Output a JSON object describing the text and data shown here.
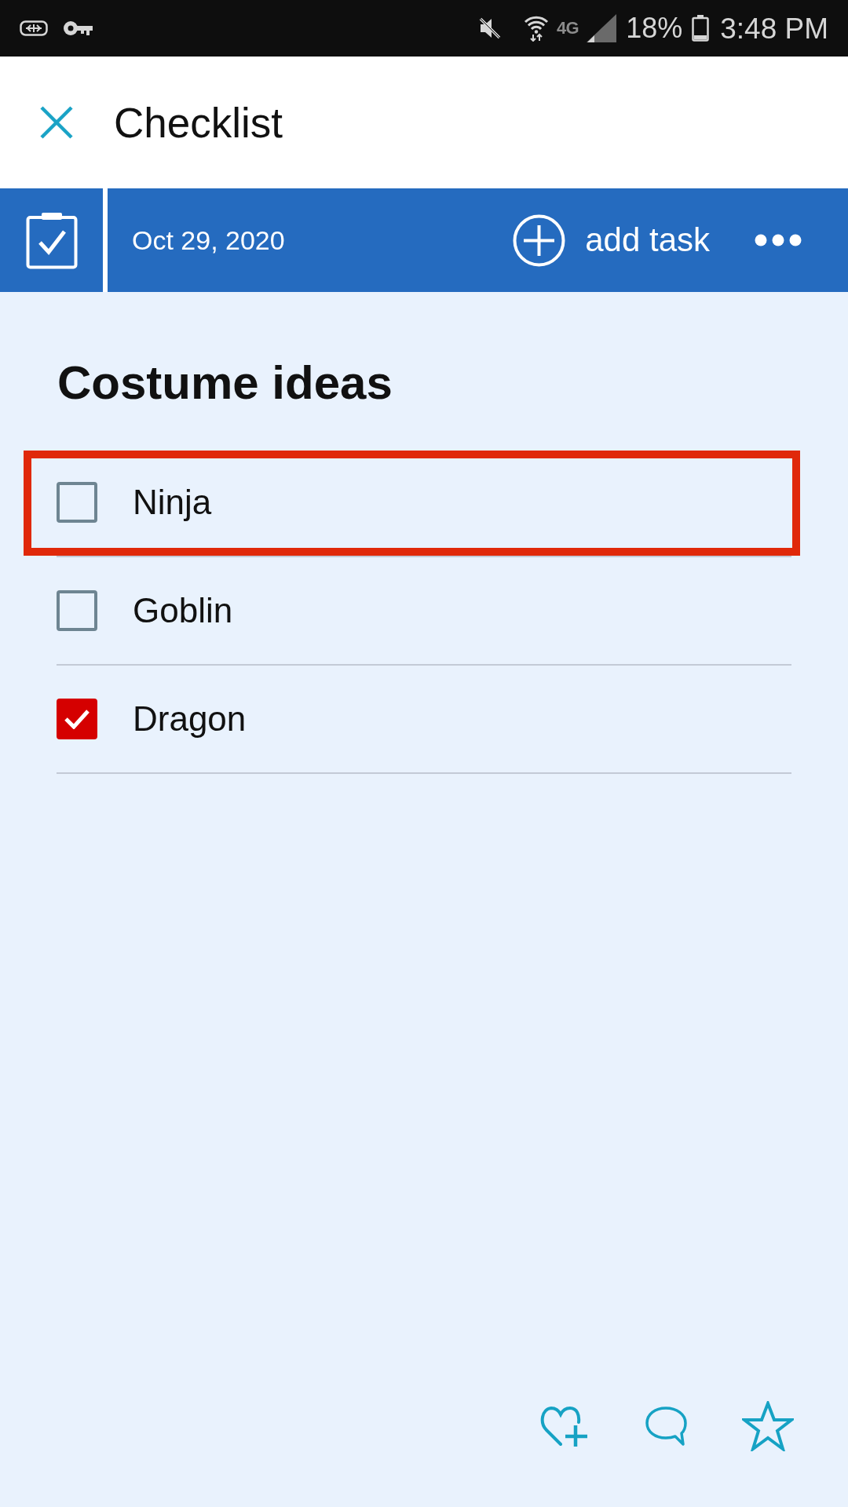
{
  "status_bar": {
    "network": "4G",
    "battery": "18%",
    "time": "3:48 PM"
  },
  "header": {
    "title": "Checklist"
  },
  "toolbar": {
    "date": "Oct 29, 2020",
    "add_task": "add task"
  },
  "checklist": {
    "title": "Costume ideas",
    "items": [
      {
        "label": "Ninja",
        "checked": false,
        "highlighted": true
      },
      {
        "label": "Goblin",
        "checked": false,
        "highlighted": false
      },
      {
        "label": "Dragon",
        "checked": true,
        "highlighted": false
      }
    ]
  }
}
